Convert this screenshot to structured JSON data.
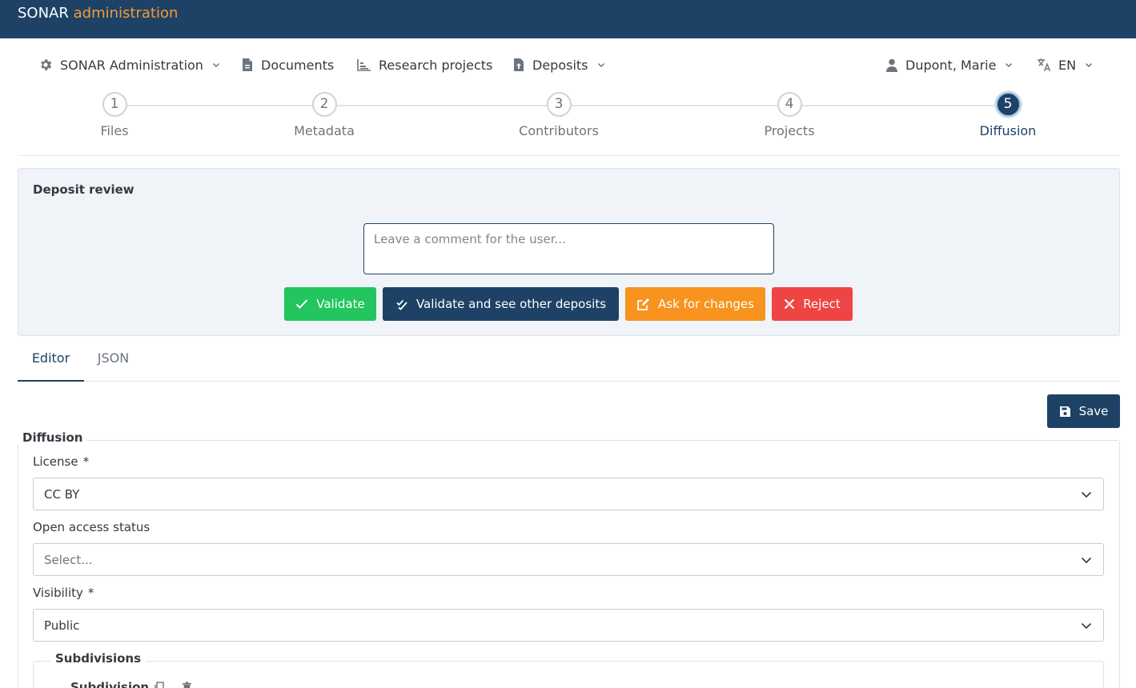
{
  "header": {
    "brand": "SONAR",
    "brand_accent": "administration"
  },
  "nav": {
    "admin": "SONAR Administration",
    "documents": "Documents",
    "research_projects": "Research projects",
    "deposits": "Deposits",
    "user": "Dupont, Marie",
    "language": "EN"
  },
  "steps": [
    {
      "number": "1",
      "label": "Files"
    },
    {
      "number": "2",
      "label": "Metadata"
    },
    {
      "number": "3",
      "label": "Contributors"
    },
    {
      "number": "4",
      "label": "Projects"
    },
    {
      "number": "5",
      "label": "Diffusion"
    }
  ],
  "active_step": 5,
  "review": {
    "title": "Deposit review",
    "comment_placeholder": "Leave a comment for the user...",
    "comment_value": "",
    "validate": "Validate",
    "validate_next": "Validate and see other deposits",
    "ask_changes": "Ask for changes",
    "reject": "Reject"
  },
  "tabs": {
    "editor": "Editor",
    "json": "JSON",
    "active": "Editor"
  },
  "toolbar": {
    "save": "Save"
  },
  "form": {
    "section": "Diffusion",
    "license_label": "License",
    "license_value": "CC BY",
    "oa_label": "Open access status",
    "oa_value": "Select...",
    "visibility_label": "Visibility",
    "visibility_value": "Public",
    "required_marker": "*",
    "subdivisions_label": "Subdivisions",
    "subdivision_label": "Subdivision"
  },
  "colors": {
    "primary": "#1d4266",
    "accent": "#f39c35",
    "success": "#22c55e",
    "warning": "#f7931e",
    "danger": "#ef4444"
  },
  "icons": {
    "admin": "gear-icon",
    "documents": "file-icon",
    "research_projects": "chart-icon",
    "deposits": "file-upload-icon",
    "user": "user-icon",
    "language": "translate-icon",
    "dropdown": "chevron-down-icon",
    "validate": "check-icon",
    "validate_next": "double-check-icon",
    "ask_changes": "edit-icon",
    "reject": "close-icon",
    "save": "floppy-icon",
    "copy": "copy-icon",
    "delete": "trash-icon"
  }
}
